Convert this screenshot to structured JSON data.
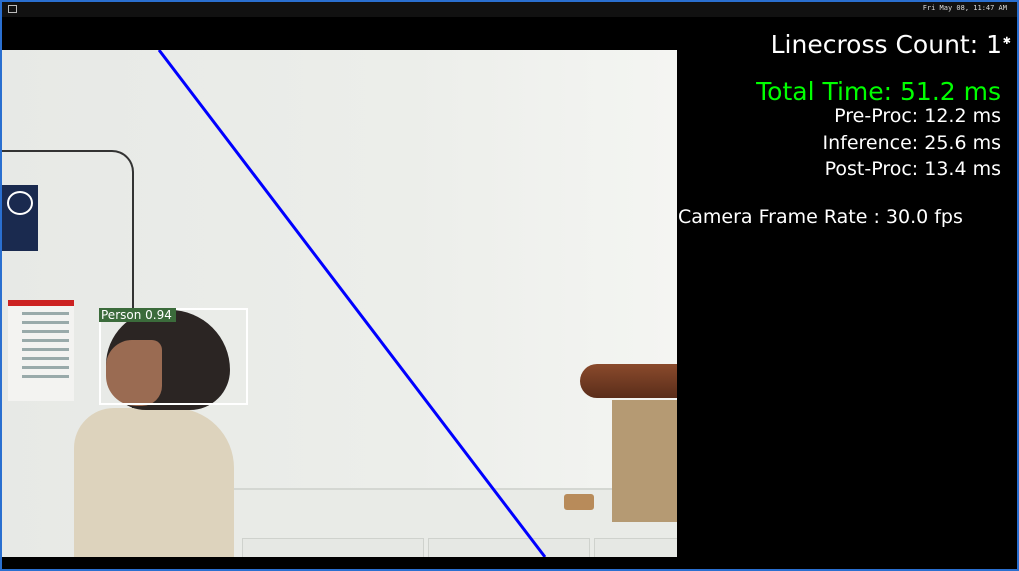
{
  "topbar": {
    "clock": "Fri May 08, 11:47 AM"
  },
  "detection": {
    "label": "Person 0.94"
  },
  "stats": {
    "linecross": "Linecross Count: 1",
    "total_time": "Total Time: 51.2 ms",
    "pre_proc": "Pre-Proc: 12.2 ms",
    "inference": "Inference: 25.6 ms",
    "post_proc": "Post-Proc: 13.4 ms",
    "camera_fps": "Camera Frame Rate : 30.0 fps"
  },
  "colors": {
    "total_time": "#00ff00",
    "crossing_line": "#0000ff",
    "bbox_label_bg": "#3b6b3b",
    "window_border": "#2a6fd0"
  }
}
